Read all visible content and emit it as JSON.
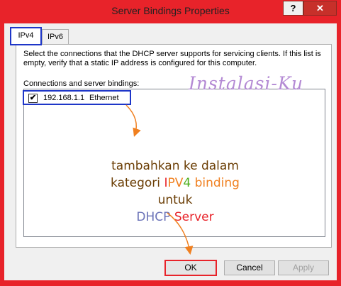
{
  "window": {
    "title": "Server Bindings Properties",
    "help_label": "?",
    "close_label": "✕"
  },
  "tabs": [
    {
      "label": "IPv4"
    },
    {
      "label": "IPv6"
    }
  ],
  "panel": {
    "description": "Select the connections that the DHCP server supports for servicing clients. If this list is empty, verify that a static IP address is configured for this computer.",
    "list_label": "Connections and server bindings:",
    "items": [
      {
        "checked": true,
        "check_mark": "✔",
        "ip": "192.168.1.1",
        "interface": "Ethernet"
      }
    ]
  },
  "annotation": {
    "line1": "tambahkan ke dalam",
    "line2_a": "kategori ",
    "line2_b": "I",
    "line2_c": "PV",
    "line2_d": "4",
    "line2_e": " binding",
    "line3": "untuk",
    "line4_a": "DHCP ",
    "line4_b": "Server"
  },
  "watermark": "Instalasi-Ku",
  "buttons": {
    "ok": "OK",
    "cancel": "Cancel",
    "apply": "Apply"
  },
  "colors": {
    "title_bar": "#e8232a",
    "highlight_box": "#1e36c8",
    "arrow": "#f08020"
  }
}
